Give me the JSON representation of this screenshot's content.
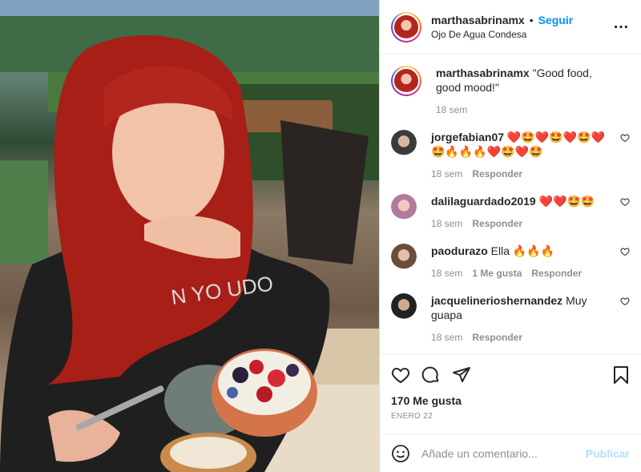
{
  "post": {
    "username": "marthasabrinamx",
    "follow_label": "Seguir",
    "location": "Ojo De Agua Condesa",
    "more_icon": "more-horizontal-icon"
  },
  "caption": {
    "username": "marthasabrinamx",
    "text": "\"Good food, good mood!\"",
    "time": "18 sem"
  },
  "comments": [
    {
      "username": "jorgefabian07",
      "text": "❤️🤩❤️🤩❤️🤩❤️🤩🔥🔥🔥❤️🤩❤️🤩",
      "time": "18 sem",
      "reply": "Responder",
      "likes": ""
    },
    {
      "username": "dalilaguardado2019",
      "text": "❤️❤️🤩🤩",
      "time": "18 sem",
      "reply": "Responder",
      "likes": ""
    },
    {
      "username": "paodurazo",
      "text": "Ella 🔥🔥🔥",
      "time": "18 sem",
      "reply": "Responder",
      "likes": "1 Me gusta"
    },
    {
      "username": "jacquelinerioshernandez",
      "text": "Muy guapa",
      "time": "18 sem",
      "reply": "Responder",
      "likes": ""
    }
  ],
  "actions": {
    "likes": "170 Me gusta",
    "date": "ENERO 22"
  },
  "add_comment": {
    "placeholder": "Añade un comentario...",
    "publish_label": "Publicar"
  }
}
